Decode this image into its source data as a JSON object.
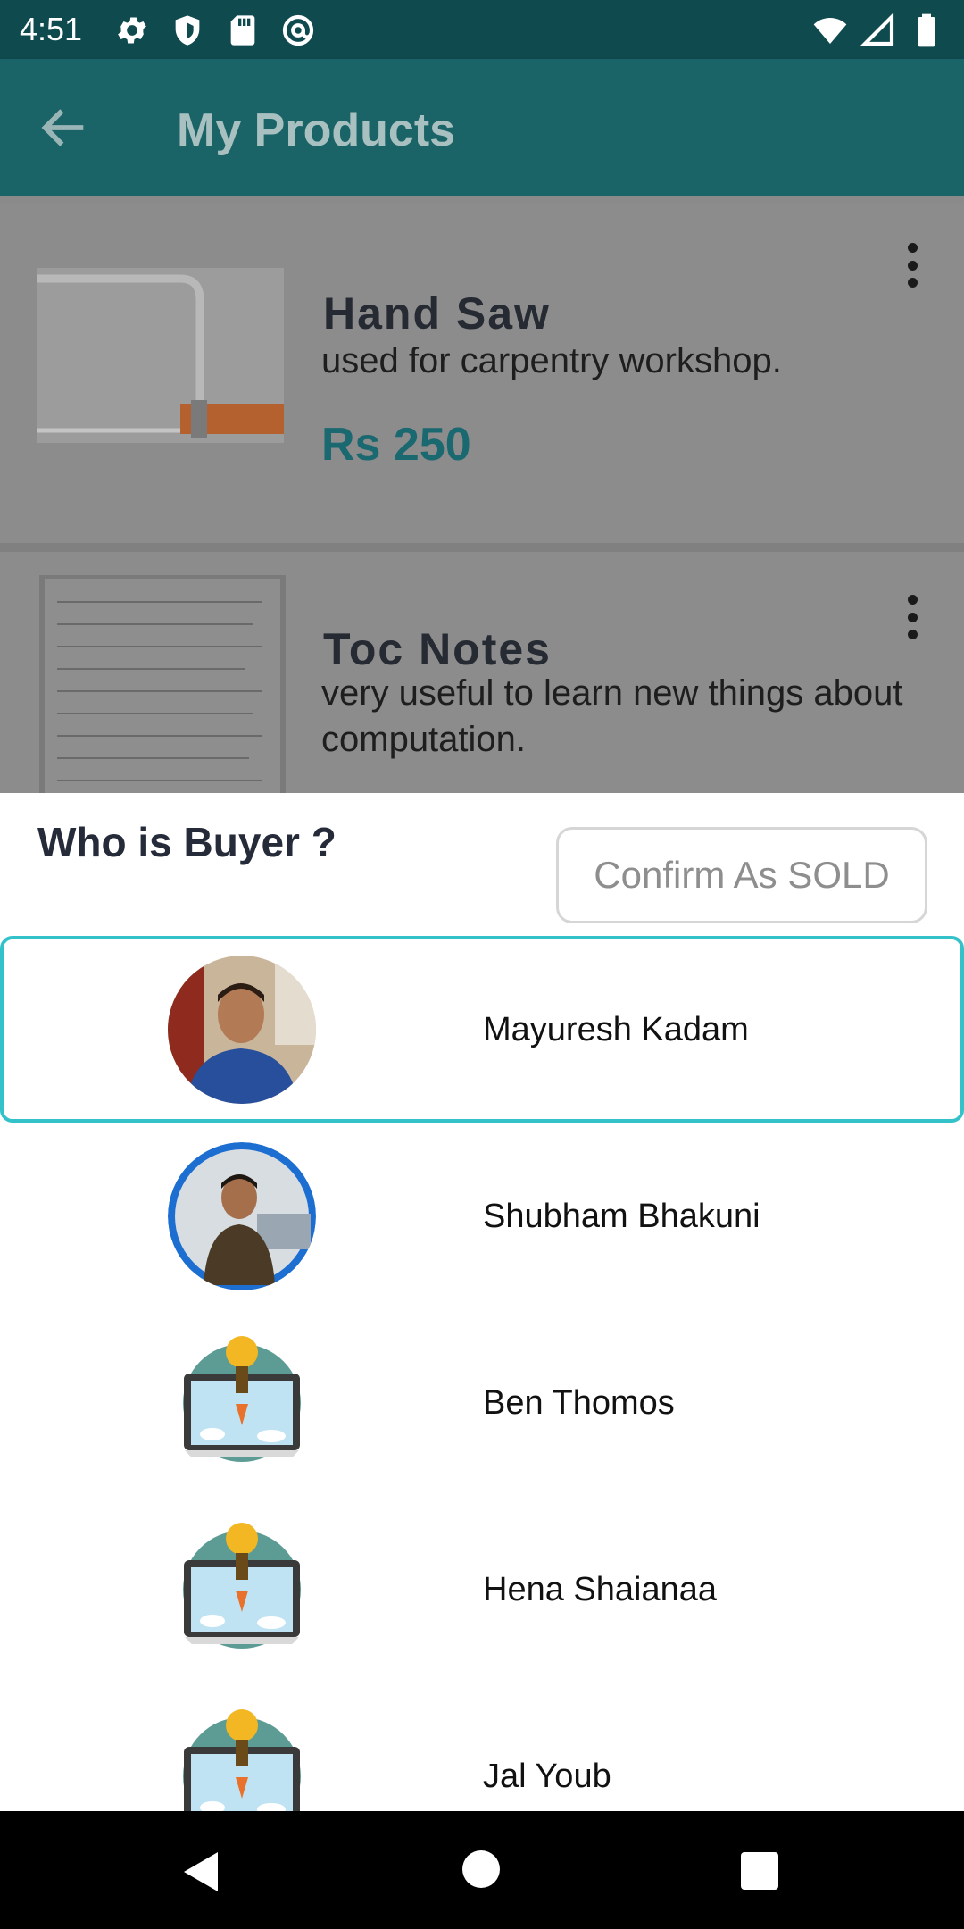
{
  "status_bar": {
    "time": "4:51",
    "left_icons": [
      "gear-icon",
      "shield-icon",
      "sd-card-icon",
      "at-sign-icon"
    ],
    "right_icons": [
      "wifi-icon",
      "cell-signal-icon",
      "battery-icon"
    ]
  },
  "app_bar": {
    "title": "My Products",
    "back_icon": "arrow-left-icon"
  },
  "products": [
    {
      "name": "Hand Saw",
      "description": "used for carpentry workshop.",
      "price": "Rs 250"
    },
    {
      "name": "Toc Notes",
      "description": "very useful to learn new things about computation."
    }
  ],
  "sheet": {
    "title": "Who is Buyer ?",
    "confirm_label": "Confirm As SOLD",
    "selected_index": 0,
    "buyers": [
      {
        "name": "Mayuresh Kadam",
        "avatar": "photo"
      },
      {
        "name": "Shubham Bhakuni",
        "avatar": "photo"
      },
      {
        "name": "Ben Thomos",
        "avatar": "default-rocket"
      },
      {
        "name": "Hena Shaianaa",
        "avatar": "default-rocket"
      },
      {
        "name": "Jal Youb",
        "avatar": "default-rocket"
      }
    ]
  },
  "colors": {
    "status_bar": "#0f4a4f",
    "app_bar": "#1a6468",
    "accent": "#33c1ca",
    "price": "#1a6870",
    "scrim": "#8a8a8a"
  }
}
